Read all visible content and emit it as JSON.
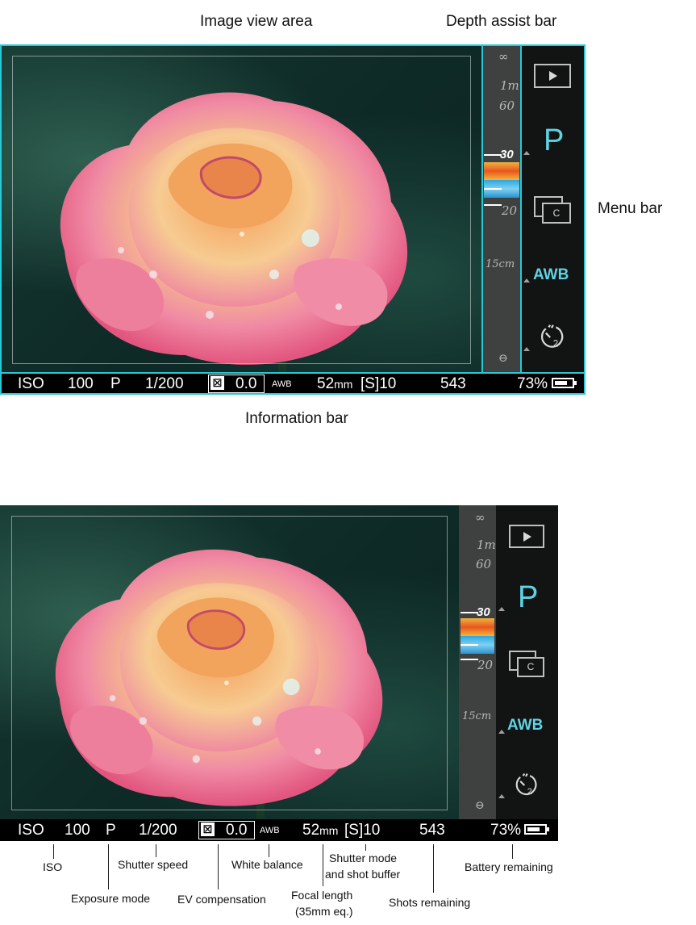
{
  "labels": {
    "image_view_area": "Image view area",
    "depth_assist_bar": "Depth assist bar",
    "menu_bar": "Menu bar",
    "information_bar": "Information bar"
  },
  "depth": {
    "infinity": "∞",
    "one_m": "1m",
    "sixty": "60",
    "thirty": "30",
    "twenty": "20",
    "fifteen_cm": "15cm",
    "bottom_symbol": "⊖"
  },
  "menu": {
    "mode": "P",
    "continuous_letter": "C",
    "awb": "AWB",
    "timer_digit": "2"
  },
  "info": {
    "iso_label": "ISO",
    "iso_value": "100",
    "exposure_mode": "P",
    "shutter_speed": "1/200",
    "ev_icon": "☒",
    "ev_value": "0.0",
    "white_balance": "AWB",
    "focal_length": "52",
    "focal_unit": "mm",
    "shutter_mode_buffer": "[S]10",
    "shots_remaining": "543",
    "battery": "73%"
  },
  "battery_level": 0.73,
  "annotations": {
    "iso": "ISO",
    "exposure_mode": "Exposure mode",
    "shutter_speed": "Shutter speed",
    "ev_compensation": "EV compensation",
    "white_balance": "White balance",
    "focal_length_1": "Focal length",
    "focal_length_2": "(35mm eq.)",
    "shutter_mode_1": "Shutter mode",
    "shutter_mode_2": "and shot buffer",
    "shots_remaining": "Shots remaining",
    "battery_remaining": "Battery remaining"
  },
  "colors": {
    "highlight": "#27c9d8",
    "accent": "#5fd3e4",
    "depth_bar": "#3f4140",
    "menu_bar": "#121414",
    "info_bar": "#000000"
  }
}
